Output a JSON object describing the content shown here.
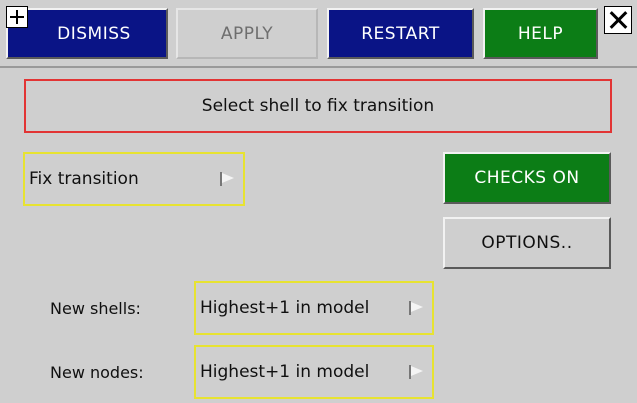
{
  "toolbar": {
    "dismiss_label": "DISMISS",
    "apply_label": "APPLY",
    "restart_label": "RESTART",
    "help_label": "HELP"
  },
  "prompt": {
    "text": "Select shell to fix transition"
  },
  "mode_select": {
    "value": "Fix transition"
  },
  "buttons": {
    "checks_label": "CHECKS ON",
    "options_label": "OPTIONS.."
  },
  "fields": [
    {
      "label": "New shells:",
      "value": "Highest+1 in model"
    },
    {
      "label": "New nodes:",
      "value": "Highest+1 in model"
    }
  ],
  "colors": {
    "navy": "#0a1486",
    "green": "#0c7d16",
    "panel": "#cfcfcf",
    "prompt_border": "#e23434",
    "select_border": "#e7e331"
  },
  "icons": {
    "corner": "plus-icon",
    "close": "close-icon",
    "dropdown": "flag-icon"
  }
}
